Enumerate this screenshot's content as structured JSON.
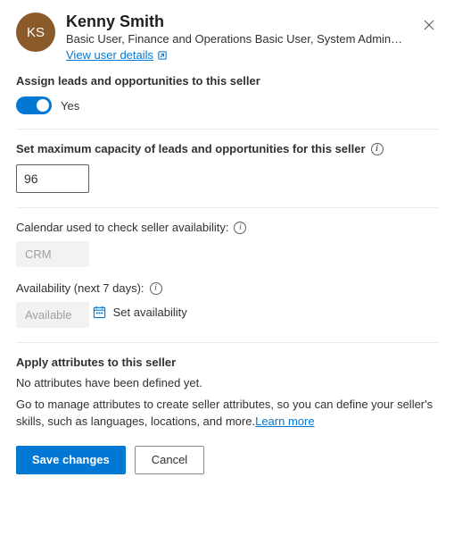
{
  "user": {
    "initials": "KS",
    "name": "Kenny Smith",
    "roles": "Basic User, Finance and Operations Basic User, System Administr...",
    "view_details_label": "View user details"
  },
  "assign": {
    "heading": "Assign leads and opportunities to this seller",
    "toggle_state": "Yes"
  },
  "capacity": {
    "heading": "Set maximum capacity of leads and opportunities for this seller",
    "value": "96"
  },
  "calendar": {
    "label": "Calendar used to check seller availability:",
    "value": "CRM"
  },
  "availability": {
    "label": "Availability (next 7 days):",
    "value": "Available",
    "set_label": "Set availability"
  },
  "attributes": {
    "heading": "Apply attributes to this seller",
    "empty_msg": "No attributes have been defined yet.",
    "help_msg": "Go to manage attributes to create seller attributes, so you can define your seller's skills, such as languages, locations, and more.",
    "learn_more": "Learn more"
  },
  "footer": {
    "save": "Save changes",
    "cancel": "Cancel"
  }
}
